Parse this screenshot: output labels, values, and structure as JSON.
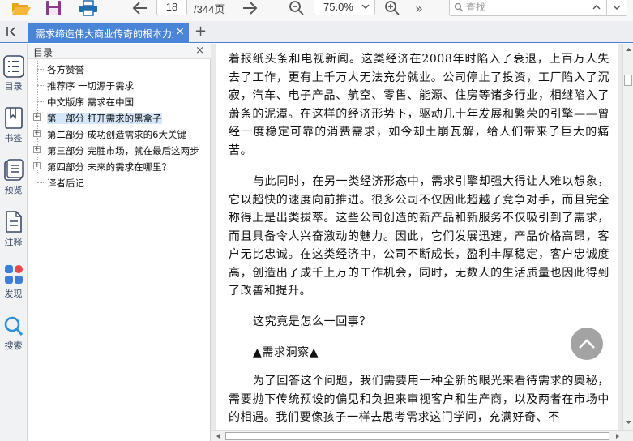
{
  "toolbar": {
    "open_icon": "folder-open-icon",
    "save_icon": "floppy-disk-icon",
    "print_icon": "printer-icon",
    "prev_icon": "arrow-left-icon",
    "current_page": "18",
    "page_total": "/344页",
    "next_icon": "arrow-right-icon",
    "zoom_out_icon": "zoom-out-icon",
    "zoom_value": "75.0%",
    "zoom_in_icon": "zoom-in-icon",
    "more_label": "»",
    "search_placeholder": "查找"
  },
  "tabs": [
    {
      "title": "需求缔造伟大商业传奇的根本力量",
      "active": true,
      "close_label": "×"
    }
  ],
  "new_tab_label": "+",
  "rail": [
    {
      "key": "toc",
      "label": "目录",
      "icon": "list-icon"
    },
    {
      "key": "bookmark",
      "label": "书签",
      "icon": "bookmark-icon"
    },
    {
      "key": "preview",
      "label": "预览",
      "icon": "thumbnails-icon"
    },
    {
      "key": "notes",
      "label": "注释",
      "icon": "note-icon"
    },
    {
      "key": "discover",
      "label": "发现",
      "icon": "apps-icon"
    },
    {
      "key": "search",
      "label": "搜索",
      "icon": "search-icon"
    }
  ],
  "toc": {
    "title": "目录",
    "close_label": "×",
    "items": [
      {
        "label": "各方赞誉",
        "expandable": false
      },
      {
        "label": "推荐序 一切源于需求",
        "expandable": false
      },
      {
        "label": "中文版序 需求在中国",
        "expandable": false
      },
      {
        "label": "第一部分 打开需求的黑盒子",
        "expandable": true,
        "selected": true
      },
      {
        "label": "第二部分 成功创造需求的6大关键",
        "expandable": true
      },
      {
        "label": "第三部分 完胜市场，就在最后这两步",
        "expandable": true
      },
      {
        "label": "第四部分 未来的需求在哪里？",
        "expandable": true
      },
      {
        "label": "译者后记",
        "expandable": false
      }
    ]
  },
  "reader": {
    "paragraphs": [
      "着报纸头条和电视新闻。这类经济在2008年时陷入了衰退，上百万人失去了工作，更有上千万人无法充分就业。公司停止了投资，工厂陷入了沉寂，汽车、电子产品、航空、零售、能源、住房等诸多行业，相继陷入了萧条的泥潭。在这样的经济形势下，驱动几十年发展和繁荣的引擎——曾经一度稳定可靠的消费需求，如今却土崩瓦解，给人们带来了巨大的痛苦。",
      "与此同时，在另一类经济形态中，需求引擎却强大得让人难以想象，它以超快的速度向前推进。很多公司不仅因此超越了竞争对手，而且完全称得上是出类拔萃。这些公司创造的新产品和新服务不仅吸引到了需求，而且具备令人兴奋激动的魅力。因此，它们发展迅速，产品价格高昂，客户无比忠诚。在这类经济中，公司不断成长，盈利丰厚稳定，客户忠诚度高，创造出了成千上万的工作机会，同时，无数人的生活质量也因此得到了改善和提升。",
      "这究竟是怎么一回事？",
      "▲需求洞察▲",
      "为了回答这个问题，我们需要用一种全新的眼光来看待需求的奥秘，需要抛下传统预设的偏见和负担来审视客户和生产商，以及两者在市场中的相遇。我们要像孩子一样去思考需求这门学问，充满好奇、不"
    ],
    "back_to_top_icon": "chevron-up-icon"
  },
  "colors": {
    "accent": "#4a84d6",
    "toolbar_bg": "#f7f7f7",
    "rail_text": "#3a4a66",
    "discover_red": "#e8484b",
    "discover_blue": "#3d7ed9"
  }
}
